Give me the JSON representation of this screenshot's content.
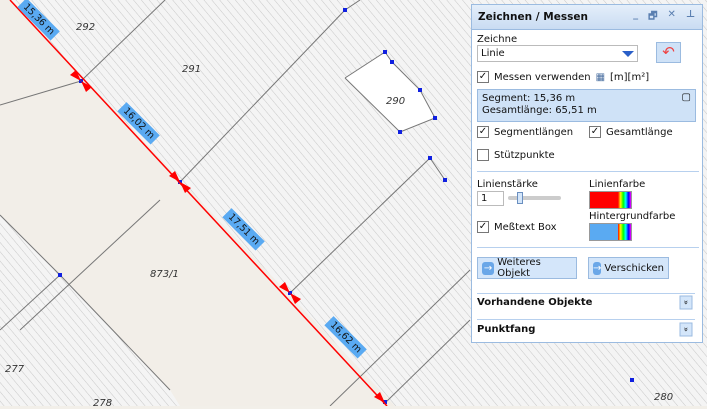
{
  "map": {
    "parcels": [
      "292",
      "291",
      "290",
      "873/1",
      "277",
      "278",
      "280"
    ],
    "segments": [
      "15,36 m",
      "16,02 m",
      "17,51 m",
      "16,62 m"
    ],
    "line_color": "#ff0000",
    "label_color": "#5aaaf2"
  },
  "panel": {
    "title": "Zeichnen / Messen",
    "tools": [
      "_",
      "🗗",
      "✕",
      "⊥"
    ],
    "draw_label": "Zeichne",
    "draw_value": "Linie",
    "undo_icon": "undo-icon",
    "measure_label": "Messen verwenden",
    "units": "[m][m²]",
    "measure_checked": true,
    "segment": "Segment: 15,36 m",
    "total": "Gesamtlänge: 65,51 m",
    "seglen_label": "Segmentlängen",
    "seglen_checked": true,
    "totallen_label": "Gesamtlänge",
    "totallen_checked": true,
    "vertices_label": "Stützpunkte",
    "vertices_checked": false,
    "linewidth_label": "Linienstärke",
    "linewidth_value": "1",
    "linecolor_label": "Linienfarbe",
    "linecolor": "#ff0000",
    "bgcolor_label": "Hintergrundfarbe",
    "bgcolor": "#5aaaf2",
    "textbox_label": "Meßtext Box",
    "textbox_checked": true,
    "btn_more": "Weiteres Objekt",
    "btn_send": "Verschicken",
    "sec_existing": "Vorhandene Objekte",
    "sec_snap": "Punktfang"
  }
}
